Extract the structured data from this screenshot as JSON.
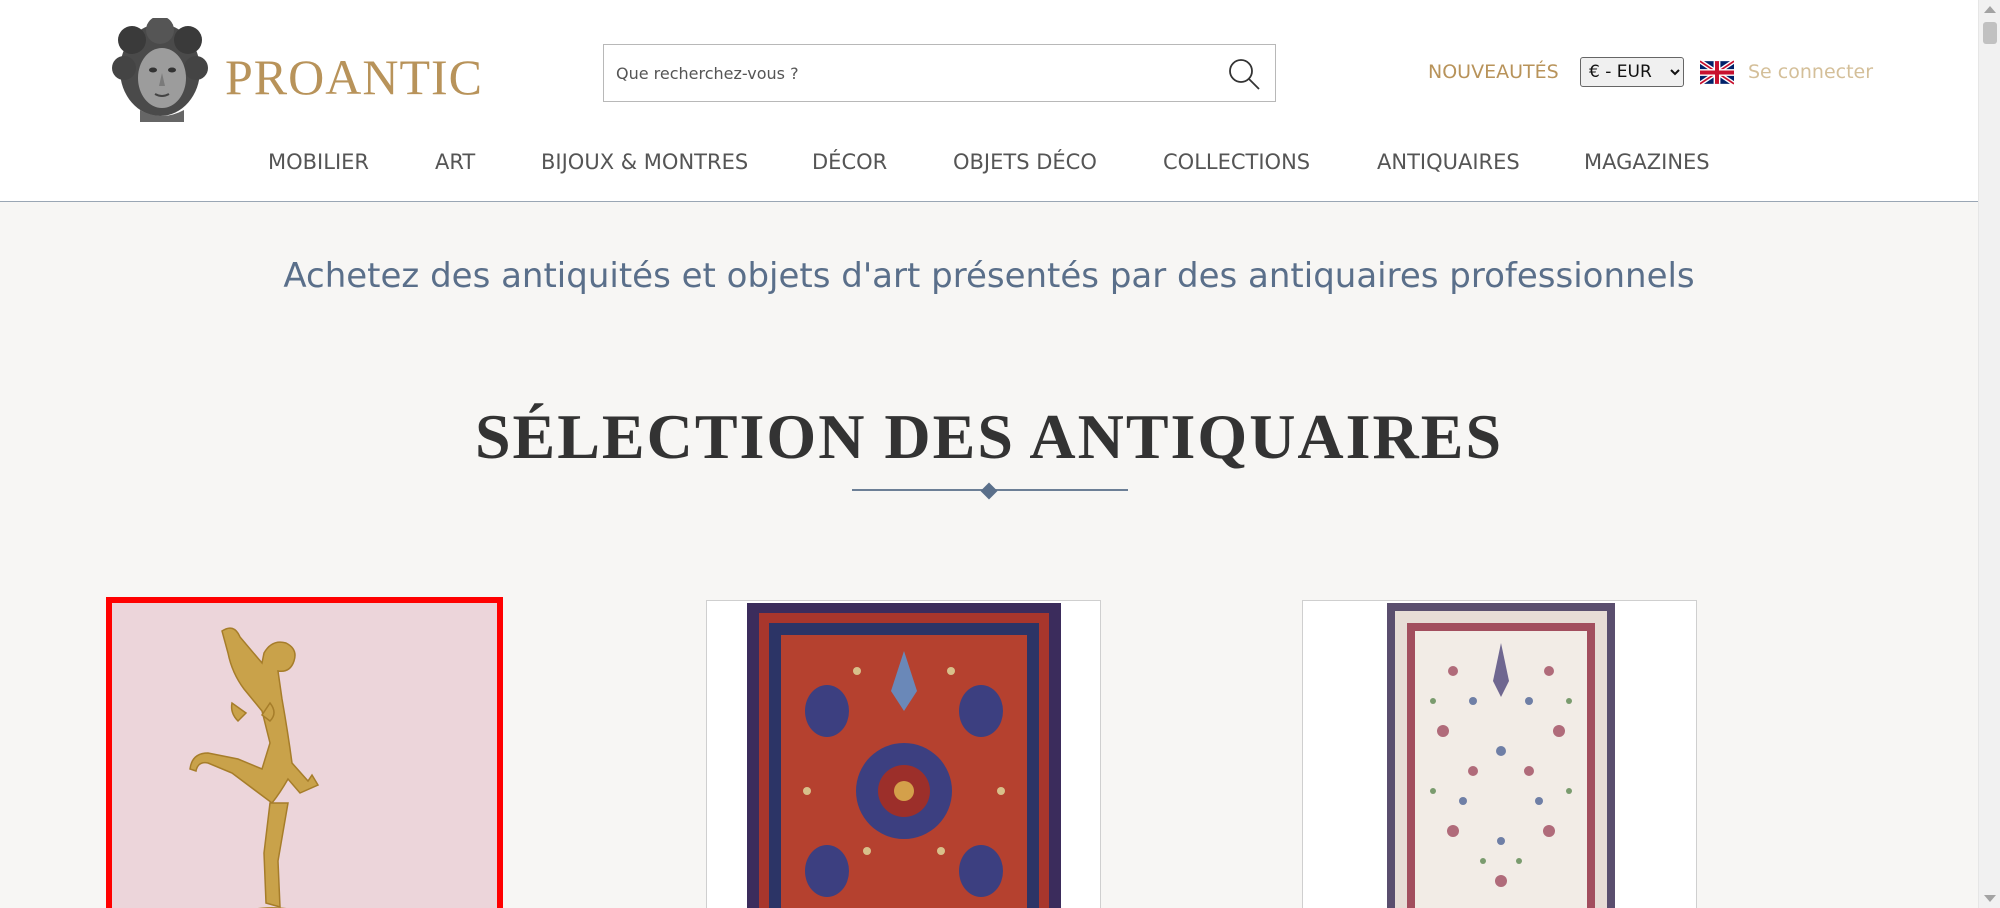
{
  "header": {
    "logo_text": "PROANTIC",
    "search": {
      "placeholder": "Que recherchez-vous ?"
    },
    "new_link": "NOUVEAUTÉS",
    "currency": {
      "selected": "€ - EUR"
    },
    "language_icon": "uk-flag-icon",
    "login_link": "Se connecter"
  },
  "nav": {
    "items": [
      {
        "label": "MOBILIER"
      },
      {
        "label": "ART"
      },
      {
        "label": "BIJOUX & MONTRES"
      },
      {
        "label": "DÉCOR"
      },
      {
        "label": "OBJETS DÉCO"
      },
      {
        "label": "COLLECTIONS"
      },
      {
        "label": "ANTIQUAIRES"
      },
      {
        "label": "MAGAZINES"
      }
    ]
  },
  "main": {
    "tagline": "Achetez des antiquités et objets d'art présentés par des antiquaires professionnels",
    "section_title": "SÉLECTION DES ANTIQUAIRES",
    "cards": [
      {
        "image": "gilt-bronze-dancer-sculpture",
        "selected": true
      },
      {
        "image": "red-persian-rug",
        "selected": false
      },
      {
        "image": "ivory-floral-rug",
        "selected": false
      }
    ]
  },
  "colors": {
    "gold": "#b8935a",
    "light_gold": "#d4bf99",
    "slate_blue": "#5a6f8a",
    "selection_red": "#ff0000",
    "background": "#f7f6f4"
  }
}
